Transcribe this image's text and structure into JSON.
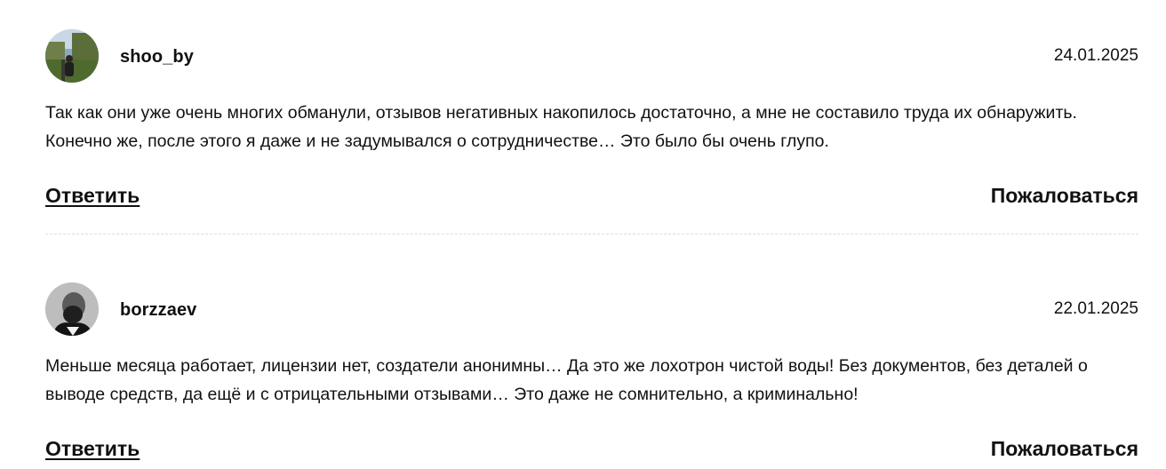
{
  "comments": [
    {
      "author": "shoo_by",
      "date": "24.01.2025",
      "text": "Так как они уже очень многих обманули, отзывов негативных накопилось достаточно, а мне не составило труда их обнаружить. Конечно же, после этого я даже и не задумывался о сотрудничестве… Это было бы очень глупо.",
      "reply_label": "Ответить",
      "report_label": "Пожаловаться"
    },
    {
      "author": "borzzaev",
      "date": "22.01.2025",
      "text": "Меньше месяца работает, лицензии нет, создатели анонимны… Да это же лохотрон чистой воды! Без документов, без деталей о выводе средств, да ещё и с отрицательными отзывами… Это даже не сомнительно, а криминально!",
      "reply_label": "Ответить",
      "report_label": "Пожаловаться"
    }
  ]
}
